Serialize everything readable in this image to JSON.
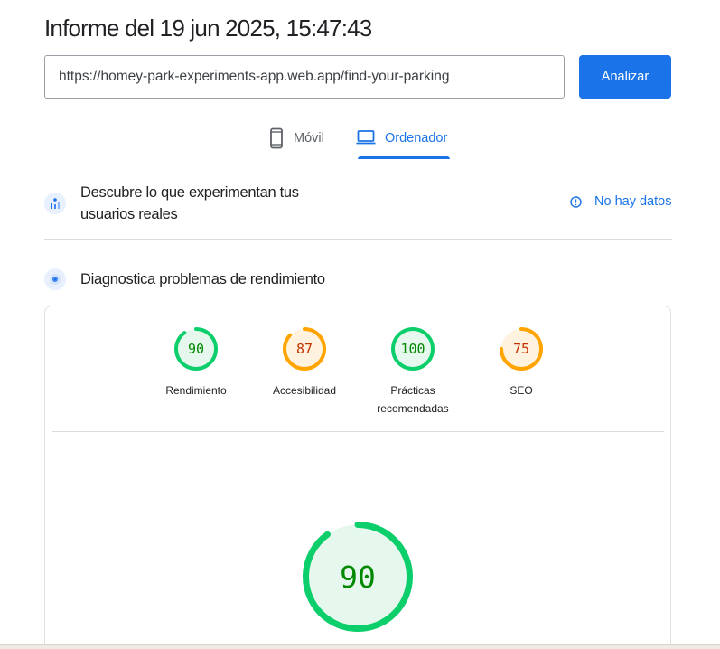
{
  "report": {
    "title": "Informe del 19 jun 2025, 15:47:43"
  },
  "url_input": {
    "value": "https://homey-park-experiments-app.web.app/find-your-parking"
  },
  "analyze_button": {
    "label": "Analizar"
  },
  "tabs": [
    {
      "label": "Móvil",
      "icon": "smartphone-icon",
      "selected": false
    },
    {
      "label": "Ordenador",
      "icon": "laptop-icon",
      "selected": true
    }
  ],
  "field_data": {
    "heading_line1": "Descubre lo que experimentan tus",
    "heading_line2": "usuarios reales",
    "status": "No hay datos",
    "icon": "users-chart-icon"
  },
  "diagnostics": {
    "heading": "Diagnostica problemas de rendimiento",
    "icon": "lighthouse-icon"
  },
  "scores": [
    {
      "label": "Rendimiento",
      "label2": "",
      "value": 90,
      "status": "pass"
    },
    {
      "label": "Accesibilidad",
      "label2": "",
      "value": 87,
      "status": "average"
    },
    {
      "label": "Prácticas",
      "label2": "recomendadas",
      "value": 100,
      "status": "pass"
    },
    {
      "label": "SEO",
      "label2": "",
      "value": 75,
      "status": "average"
    }
  ],
  "main_score": {
    "value": 90,
    "status": "pass"
  },
  "colors": {
    "pass": "#0cce6b",
    "pass_text": "#008800",
    "pass_bg": "#e6f8ee",
    "average": "#ffa400",
    "average_text": "#c33300",
    "average_bg": "#fff3e0",
    "accent": "#1a73e8"
  }
}
